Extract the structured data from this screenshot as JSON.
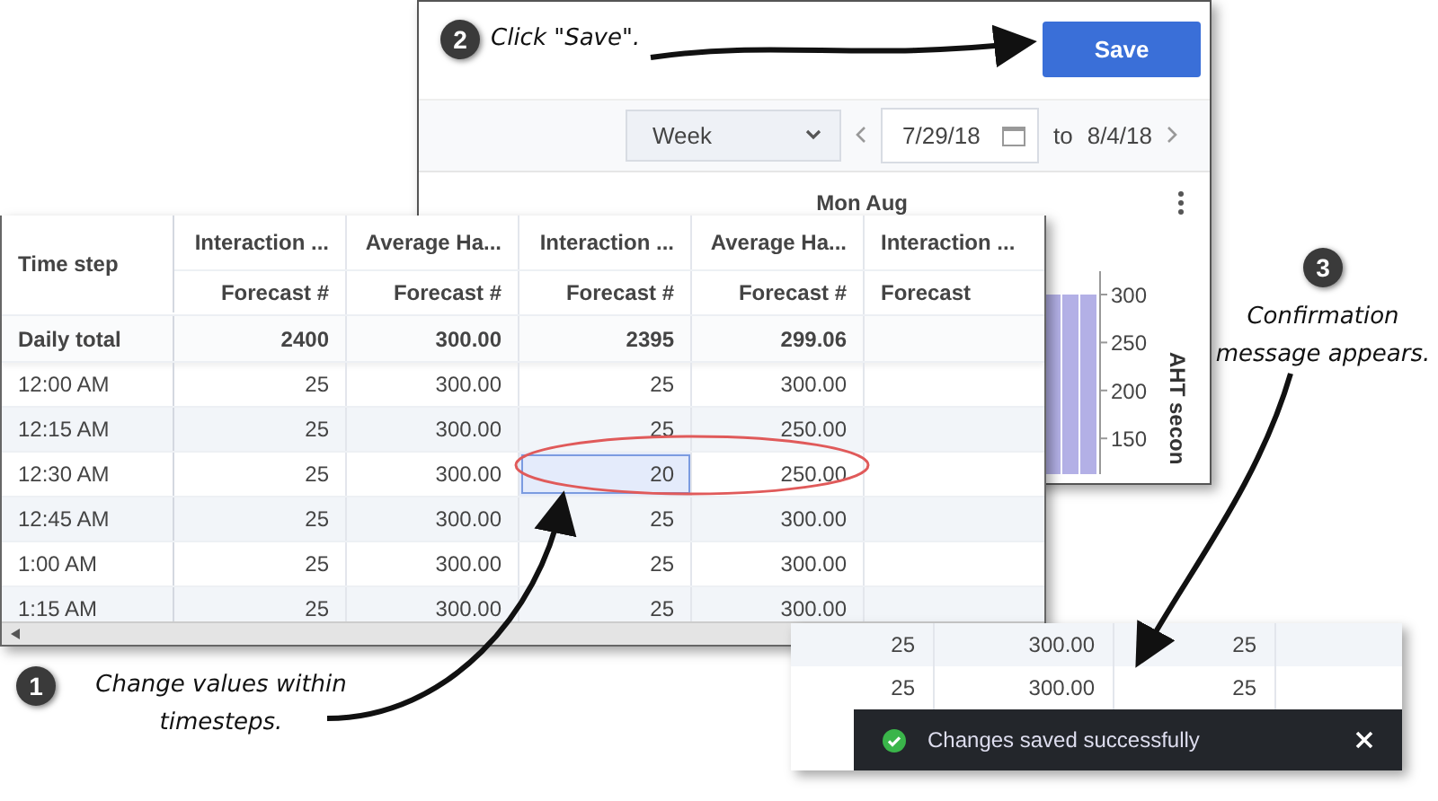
{
  "annotations": [
    {
      "step": "2",
      "text": "Click \"Save\"."
    },
    {
      "step": "1",
      "text": "Change values within timesteps."
    },
    {
      "step": "3",
      "text": "Confirmation message appears."
    }
  ],
  "toolbar": {
    "save_button": "Save",
    "period": "Week",
    "start_date": "7/29/18",
    "to_label": "to",
    "end_date": "8/4/18"
  },
  "date_band": {
    "label": "Mon Aug"
  },
  "chart": {
    "axis_title": "AHT secon",
    "tick_labels": [
      "300",
      "250",
      "200",
      "150"
    ]
  },
  "grid": {
    "first_column": "Time step",
    "columns": [
      {
        "title": "Interaction ...",
        "subtitle": "Forecast #"
      },
      {
        "title": "Average Ha...",
        "subtitle": "Forecast #"
      },
      {
        "title": "Interaction ...",
        "subtitle": "Forecast #"
      },
      {
        "title": "Average Ha...",
        "subtitle": "Forecast #"
      },
      {
        "title": "Interaction ...",
        "subtitle": "Forecast"
      }
    ],
    "total_row": {
      "label": "Daily total",
      "cells": [
        "2400",
        "300.00",
        "2395",
        "299.06"
      ]
    },
    "rows": [
      {
        "time": "12:00 AM",
        "cells": [
          {
            "text": "25",
            "selected": false
          },
          {
            "text": "300.00",
            "selected": false
          },
          {
            "text": "25",
            "selected": false
          },
          {
            "text": "300.00",
            "selected": false
          }
        ]
      },
      {
        "time": "12:15 AM",
        "cells": [
          {
            "text": "25",
            "selected": false
          },
          {
            "text": "300.00",
            "selected": false
          },
          {
            "text": "25",
            "selected": false
          },
          {
            "text": "250.00",
            "selected": false
          }
        ]
      },
      {
        "time": "12:30 AM",
        "cells": [
          {
            "text": "25",
            "selected": false
          },
          {
            "text": "300.00",
            "selected": false
          },
          {
            "text": "20",
            "selected": true
          },
          {
            "text": "250.00",
            "selected": false
          }
        ]
      },
      {
        "time": "12:45 AM",
        "cells": [
          {
            "text": "25",
            "selected": false
          },
          {
            "text": "300.00",
            "selected": false
          },
          {
            "text": "25",
            "selected": false
          },
          {
            "text": "300.00",
            "selected": false
          }
        ]
      },
      {
        "time": "1:00 AM",
        "cells": [
          {
            "text": "25",
            "selected": false
          },
          {
            "text": "300.00",
            "selected": false
          },
          {
            "text": "25",
            "selected": false
          },
          {
            "text": "300.00",
            "selected": false
          }
        ]
      },
      {
        "time": "1:15 AM",
        "cells": [
          {
            "text": "25",
            "selected": false
          },
          {
            "text": "300.00",
            "selected": false
          },
          {
            "text": "25",
            "selected": false
          },
          {
            "text": "300.00",
            "selected": false
          }
        ]
      }
    ]
  },
  "snippet": {
    "rows": [
      [
        "25",
        "300.00",
        "25"
      ],
      [
        "25",
        "300.00",
        "25"
      ]
    ]
  },
  "toast": {
    "message": "Changes saved successfully"
  }
}
